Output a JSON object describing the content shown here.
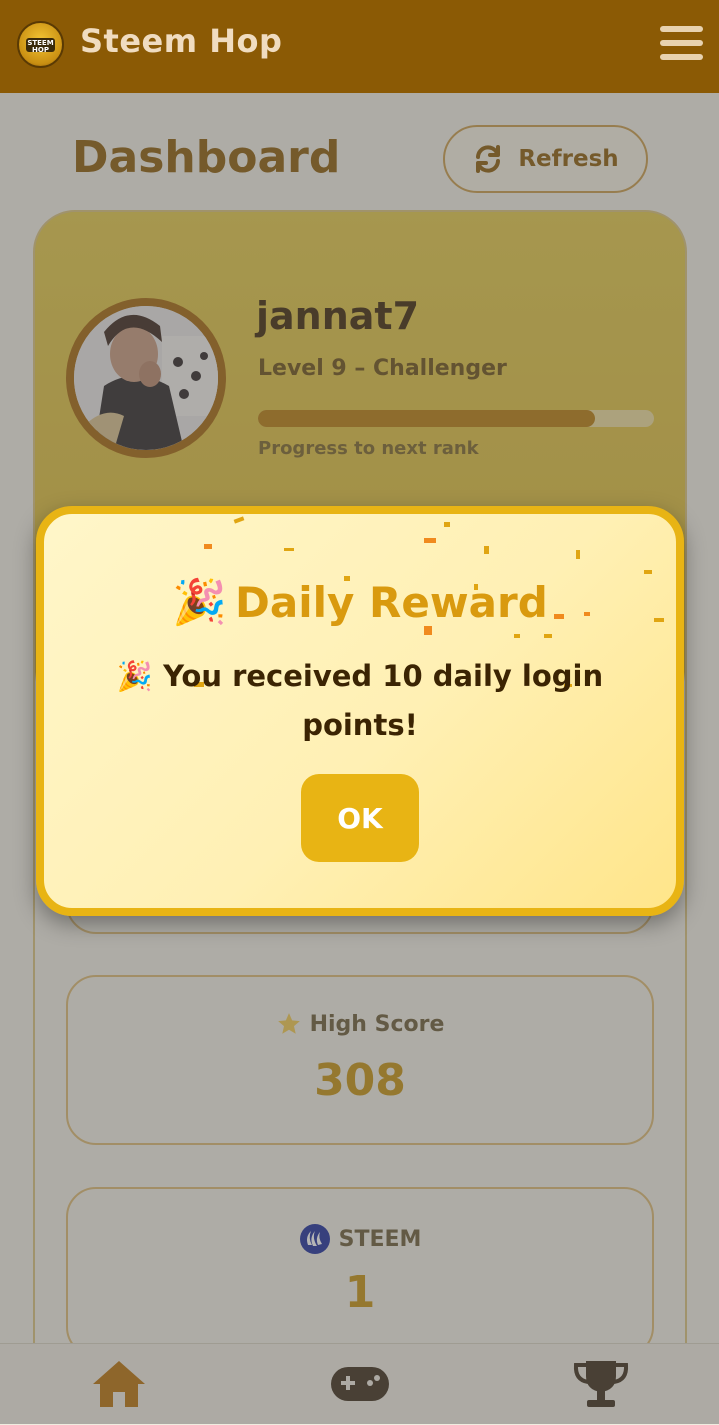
{
  "header": {
    "app_title": "Steem Hop",
    "logo_text_1": "STEEM",
    "logo_text_2": "HOP"
  },
  "page": {
    "title": "Dashboard",
    "refresh_label": "Refresh"
  },
  "profile": {
    "username": "jannat7",
    "level": "Level 9 – Challenger",
    "progress_percent": 85,
    "progress_label": "Progress to next rank"
  },
  "stats": [
    {
      "label": "High Score",
      "value": "308",
      "icon": "star-icon"
    },
    {
      "label": "STEEM",
      "value": "1",
      "icon": "steem-icon"
    }
  ],
  "nav": {
    "items": [
      "home-icon",
      "gamepad-icon",
      "trophy-icon"
    ]
  },
  "modal": {
    "emoji": "🎉",
    "title": "Daily Reward",
    "message": "🎉 You received 10 daily login points!",
    "ok_label": "OK"
  },
  "colors": {
    "header": "#8b5a05",
    "accent": "#e8b414",
    "brown": "#8b5a05"
  }
}
